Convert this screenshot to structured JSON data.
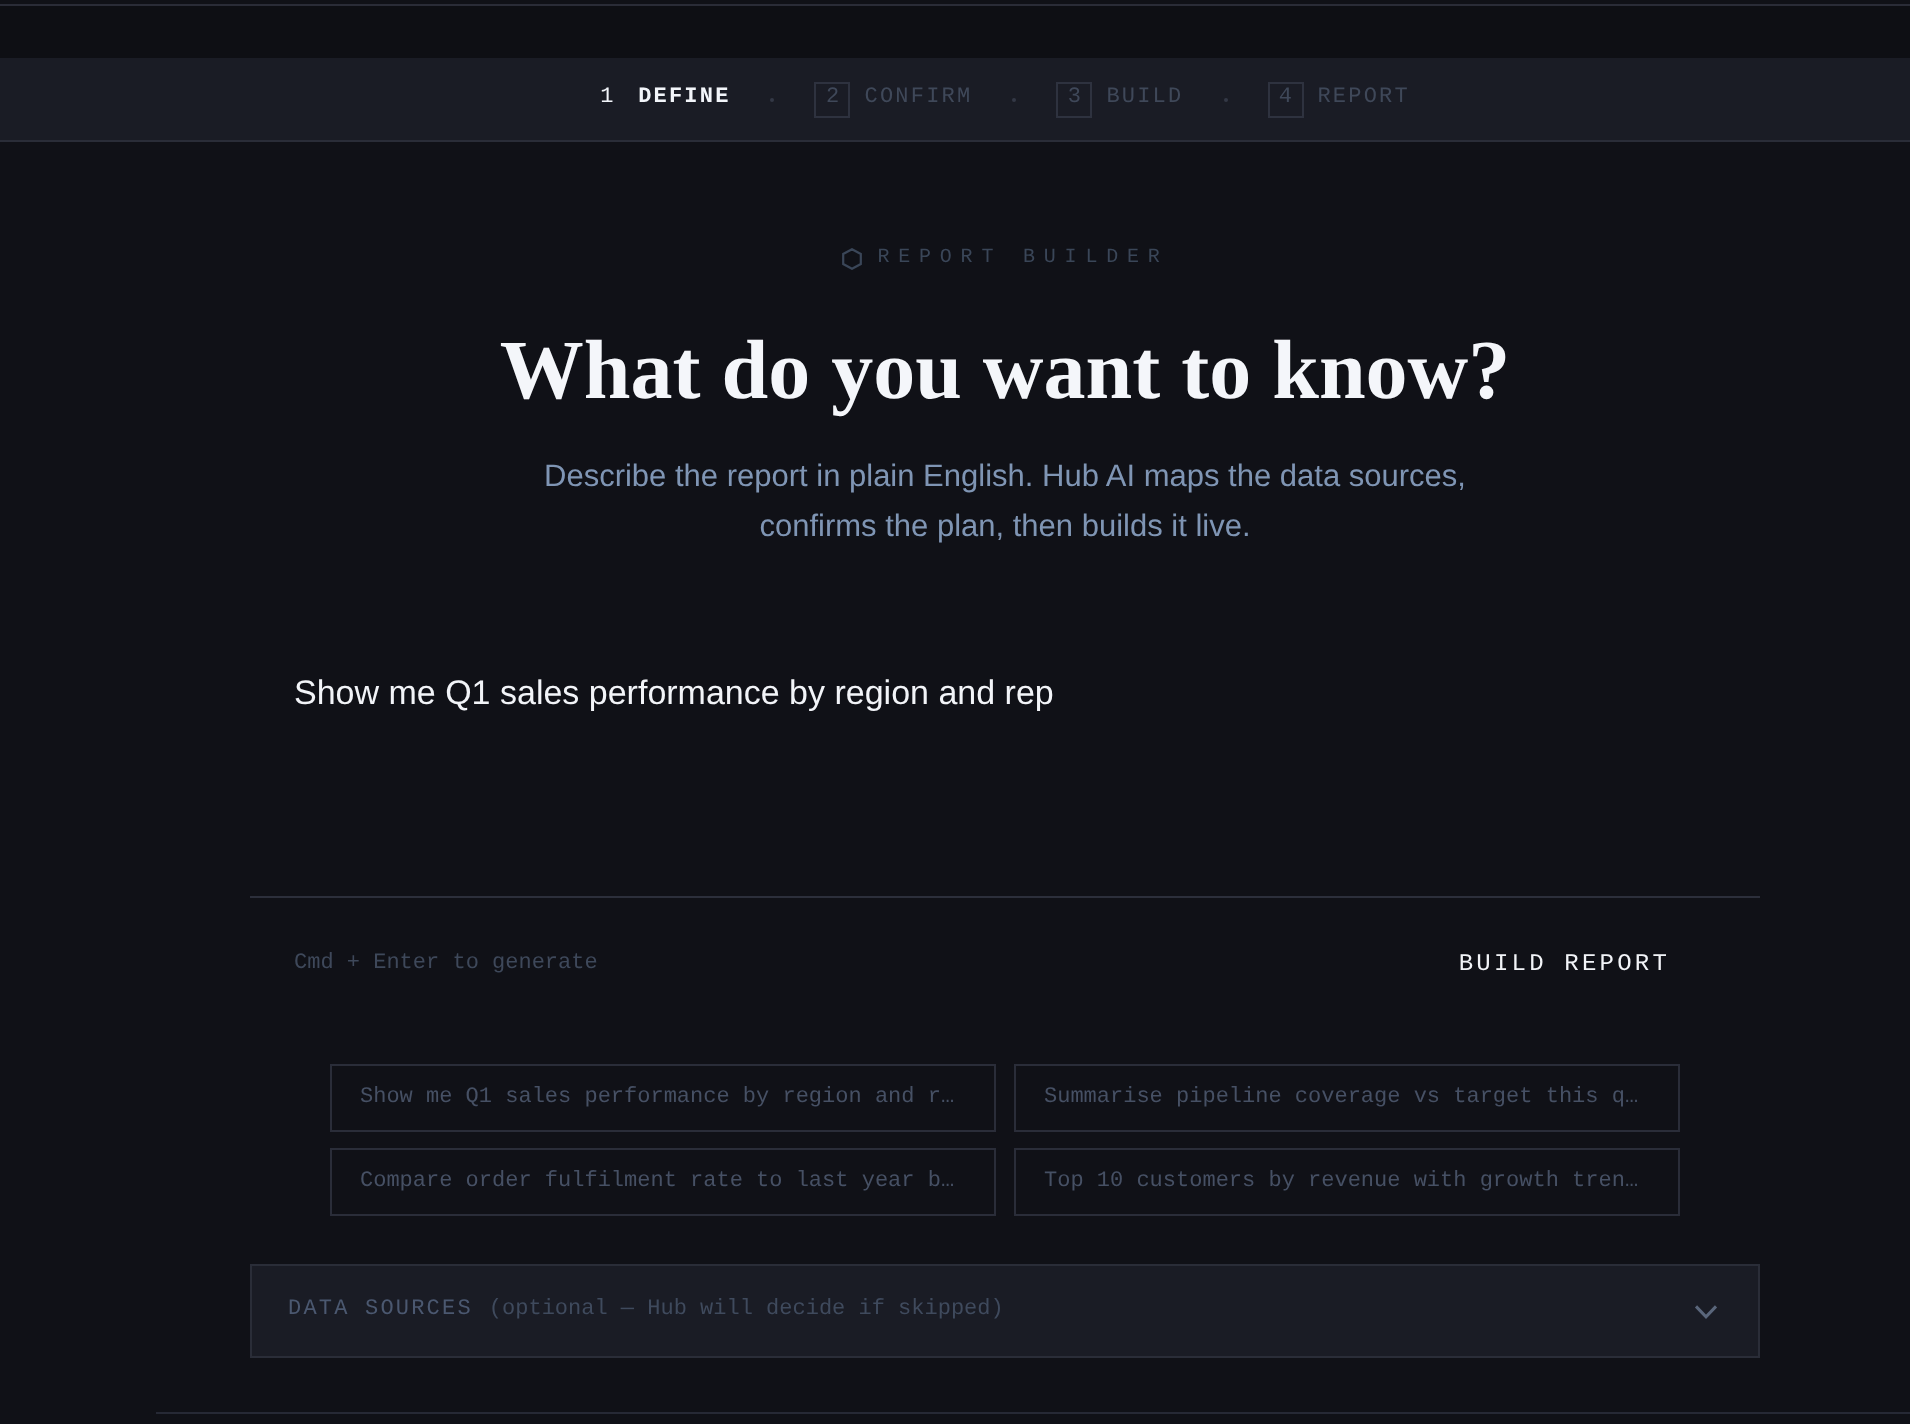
{
  "stepper": {
    "steps": [
      {
        "number": "1",
        "label": "DEFINE",
        "selected": true
      },
      {
        "number": "2",
        "label": "CONFIRM",
        "selected": false
      },
      {
        "number": "3",
        "label": "BUILD",
        "selected": false
      },
      {
        "number": "4",
        "label": "REPORT",
        "selected": false
      }
    ]
  },
  "header": {
    "eyebrow": "REPORT BUILDER",
    "title": "What do you want to know?",
    "subtitle": "Describe the report in plain English. Hub AI maps the data sources, confirms the plan, then builds it live."
  },
  "prompt": {
    "value": "Show me Q1 sales performance by region and rep",
    "hint": "Cmd + Enter to generate",
    "submit_button": "BUILD REPORT"
  },
  "suggestions": [
    "Show me Q1 sales performance by region and r…",
    "Summarise pipeline coverage vs target this q…",
    "Compare order fulfilment rate to last year b…",
    "Top 10 customers by revenue with growth tren…"
  ],
  "data_sources": {
    "label": "DATA SOURCES",
    "note": "(optional — Hub will decide if skipped)",
    "expanded": false
  }
}
